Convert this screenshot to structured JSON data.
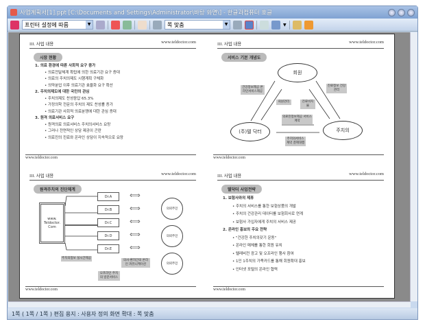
{
  "window": {
    "title": "사업계획서[1].ppt [C:\\Documents and Settings\\Administrator\\바탕 화면\\] - 한글과컴퓨터 호글"
  },
  "toolbar": {
    "printer_select": "프린터 설정에 따름",
    "zoom_select": "쪽 맞춤"
  },
  "status": {
    "text": "1쪽 ( 1쪽 / 1쪽 ) 편집 용지 : 사용자 정의  화면 확대 : 쪽 맞춤"
  },
  "slides": {
    "header_left": "III. 사업 내용",
    "header_right": "www.teldoctor.com",
    "footer": "www.teldoctor.com",
    "s1": {
      "pill": "시장 현황",
      "items": [
        {
          "t": "1. 의료 환경에 따른 사회적 요구 증가",
          "b": true
        },
        {
          "t": "• 의료전달체계 확립에 의한 의료기관 요구 증대",
          "b": false
        },
        {
          "t": "• 의료의 주치의제도 시행계획 구체화",
          "b": false
        },
        {
          "t": "• 의약분업 이후 의료기관 효율화 요구 확산",
          "b": false
        },
        {
          "t": "2. 주치의제도에 대한 국민의 관심",
          "b": true
        },
        {
          "t": "• 주치의제도 찬성응답 65.3%",
          "b": false
        },
        {
          "t": "• 가정의학 전문의 주치의 제도 찬성률 증가",
          "b": false
        },
        {
          "t": "• 의료기관 사회적 의료분쟁에 대한 관심 증대",
          "b": false
        },
        {
          "t": "3. 원격 의료서비스 요구",
          "b": true
        },
        {
          "t": "• 원격의료 의료서비스 주치의서비스 요망",
          "b": false
        },
        {
          "t": "• 그러나 전면적인 상담 제공이 곤란",
          "b": false
        },
        {
          "t": "• 의료진의 진료와 온라인 상담이 지속적으로 요망",
          "b": false
        }
      ]
    },
    "s2": {
      "pill": "서비스 기본 개념도",
      "member": "회원",
      "company": "(주)텔 닥터",
      "doctor": "주치의",
      "b1": "건강정보제공 온라인서비스제공",
      "b2": "회원관리",
      "b3": "진료비지불",
      "b4": "진료정보 건강관리",
      "b5": "의료진정보제공 서비스계약",
      "b6": "주치의서비스 계약 결제대행"
    },
    "s3": {
      "pill": "원격주치의 진단체계",
      "site": "www. Teldoctor. Com",
      "doctors": [
        "Dr.A",
        "Dr.B",
        "Dr.C",
        "Dr.D",
        "Dr.E"
      ],
      "patient": "의뢰주민",
      "b1": "주치의정보 실시간제공",
      "b2": "의사-환자간의 온라인 커뮤니케이션",
      "b3": "오프라인 주치의 방문서비스"
    },
    "s4": {
      "pill": "텔닥터 사업전략",
      "items": [
        {
          "t": "1. 보험사와의 제휴",
          "b": true
        },
        {
          "t": "• 주치의 서비스를 통한 보험상품의 개발",
          "b": false
        },
        {
          "t": "• 주치의 건강관리 데이터를 보험회사로 연계",
          "b": false
        },
        {
          "t": "• 보험사 가입자에게 주치의 서비스 제공",
          "b": false
        },
        {
          "t": "2. 온라인 홍보의 주요 전략",
          "b": true
        },
        {
          "t": "• \"건강한 주치의갖기 운동\"",
          "b": false
        },
        {
          "t": "• 온라인 매체를 통한 회원 유치",
          "b": false
        },
        {
          "t": "• 텔레비전 광고 및 오프라인 행사 참여",
          "b": false
        },
        {
          "t": "• 1인 1주치의 가족카드를 통해 회원확대 홍보",
          "b": false
        },
        {
          "t": "• 인터넷 포털의 온라인 협력",
          "b": false
        }
      ]
    }
  }
}
